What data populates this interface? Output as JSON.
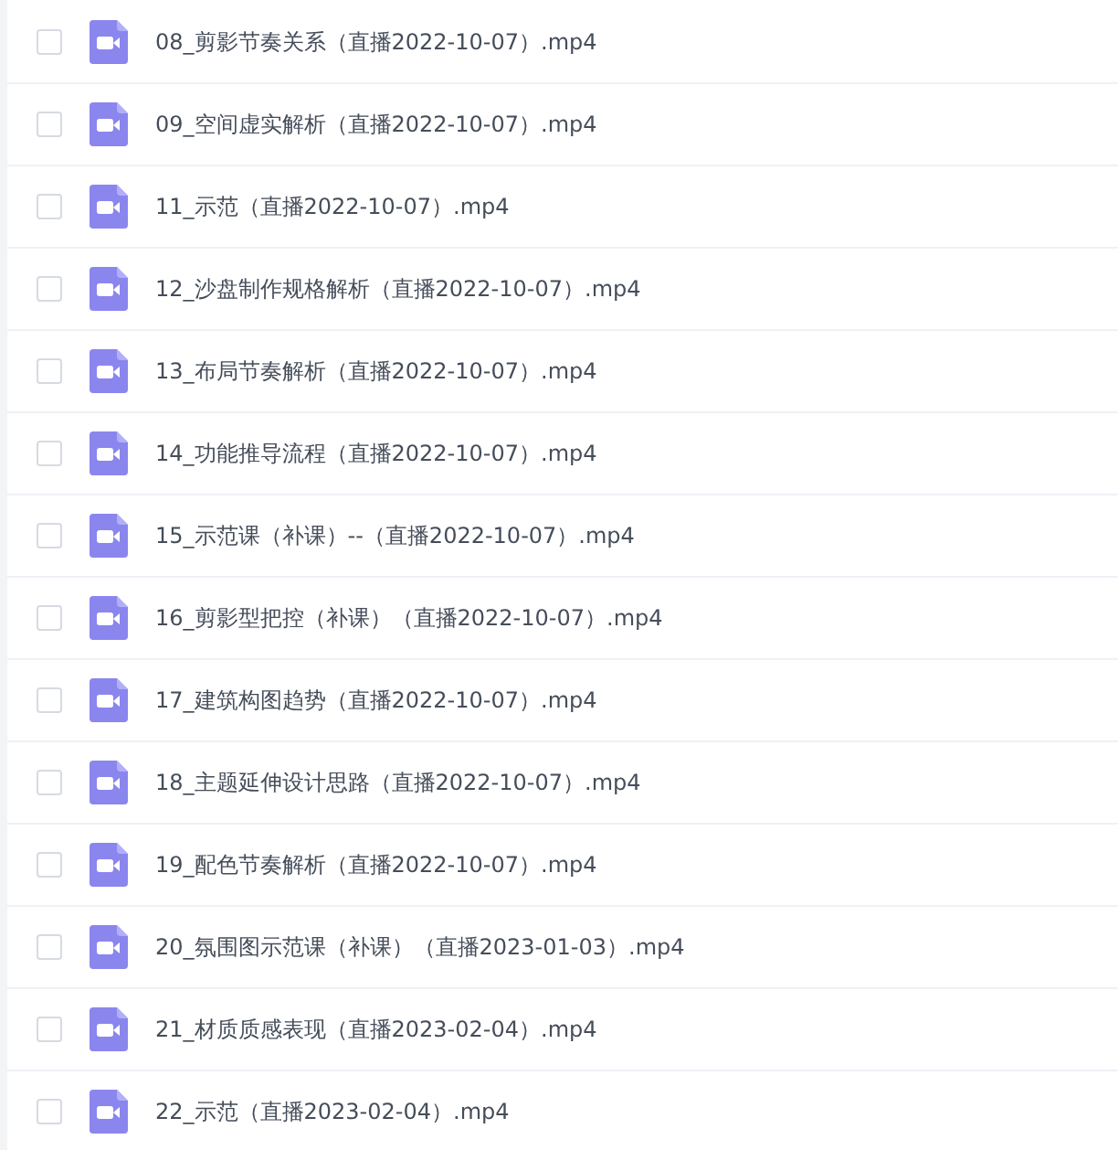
{
  "files": [
    {
      "name": "08_剪影节奏关系（直播2022-10-07）.mp4",
      "checked": false
    },
    {
      "name": "09_空间虚实解析（直播2022-10-07）.mp4",
      "checked": false
    },
    {
      "name": "11_示范（直播2022-10-07）.mp4",
      "checked": false
    },
    {
      "name": "12_沙盘制作规格解析（直播2022-10-07）.mp4",
      "checked": false
    },
    {
      "name": "13_布局节奏解析（直播2022-10-07）.mp4",
      "checked": false
    },
    {
      "name": "14_功能推导流程（直播2022-10-07）.mp4",
      "checked": false
    },
    {
      "name": "15_示范课（补课）--（直播2022-10-07）.mp4",
      "checked": false
    },
    {
      "name": "16_剪影型把控（补课）（直播2022-10-07）.mp4",
      "checked": false
    },
    {
      "name": "17_建筑构图趋势（直播2022-10-07）.mp4",
      "checked": false
    },
    {
      "name": "18_主题延伸设计思路（直播2022-10-07）.mp4",
      "checked": false
    },
    {
      "name": "19_配色节奏解析（直播2022-10-07）.mp4",
      "checked": false
    },
    {
      "name": "20_氛围图示范课（补课）（直播2023-01-03）.mp4",
      "checked": false
    },
    {
      "name": "21_材质质感表现（直播2023-02-04）.mp4",
      "checked": false
    },
    {
      "name": "22_示范（直播2023-02-04）.mp4",
      "checked": false
    }
  ]
}
